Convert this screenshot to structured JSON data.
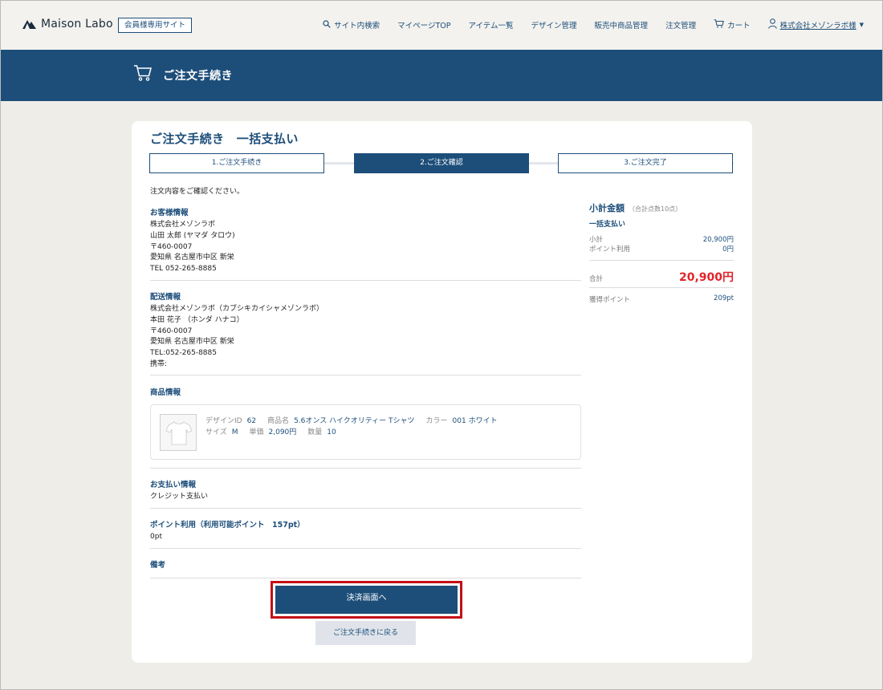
{
  "header": {
    "logo_text": "Maison Labo",
    "badge": "会員様専用サイト",
    "nav": {
      "search": "サイト内検索",
      "mypage": "マイページTOP",
      "items": "アイテム一覧",
      "design": "デザイン管理",
      "selling": "販売中商品管理",
      "orders": "注文管理",
      "cart": "カート",
      "user": "株式会社メゾンラボ様"
    }
  },
  "banner": {
    "title": "ご注文手続き",
    "icon": "cart-icon"
  },
  "page": {
    "title": "ご注文手続き　一括支払い",
    "steps": [
      "1.ご注文手続き",
      "2.ご注文確認",
      "3.ご注文完了"
    ],
    "intro": "注文内容をご確認ください。"
  },
  "customer": {
    "title": "お客様情報",
    "company": "株式会社メゾンラボ",
    "name": "山田 太郎 (ヤマダ タロウ)",
    "zip": "〒460-0007",
    "address": "愛知県 名古屋市中区 新栄",
    "tel": "TEL 052-265-8885"
  },
  "shipping": {
    "title": "配送情報",
    "company": "株式会社メゾンラボ（カブシキカイシャメゾンラボ）",
    "name": "本田 花子 （ホンダ ハナコ）",
    "zip": "〒460-0007",
    "address": "愛知県 名古屋市中区 新栄",
    "tel": "TEL:052-265-8885",
    "mobile": "携帯:"
  },
  "product": {
    "title": "商品情報",
    "design_id_label": "デザインID",
    "design_id": "62",
    "name_label": "商品名",
    "name": "5.6オンス ハイクオリティー Tシャツ",
    "color_label": "カラー",
    "color": "001 ホワイト",
    "size_label": "サイズ",
    "size": "M",
    "unit_price_label": "単価",
    "unit_price": "2,090円",
    "qty_label": "数量",
    "qty": "10"
  },
  "payment": {
    "title": "お支払い情報",
    "method": "クレジット支払い"
  },
  "points": {
    "title": "ポイント利用（利用可能ポイント　157pt）",
    "value": "0pt"
  },
  "remarks": {
    "title": "備考"
  },
  "buttons": {
    "proceed": "決済画面へ",
    "back": "ご注文手続きに戻る"
  },
  "summary": {
    "title": "小計金額",
    "count": "（合計点数10点）",
    "method": "一括支払い",
    "subtotal_label": "小計",
    "subtotal": "20,900円",
    "points_used_label": "ポイント利用",
    "points_used": "0円",
    "total_label": "合計",
    "total": "20,900円",
    "earned_label": "獲得ポイント",
    "earned": "209pt"
  },
  "colors": {
    "navy": "#1d4e7a",
    "highlight": "#c40f16",
    "total_red": "#e0252b"
  }
}
